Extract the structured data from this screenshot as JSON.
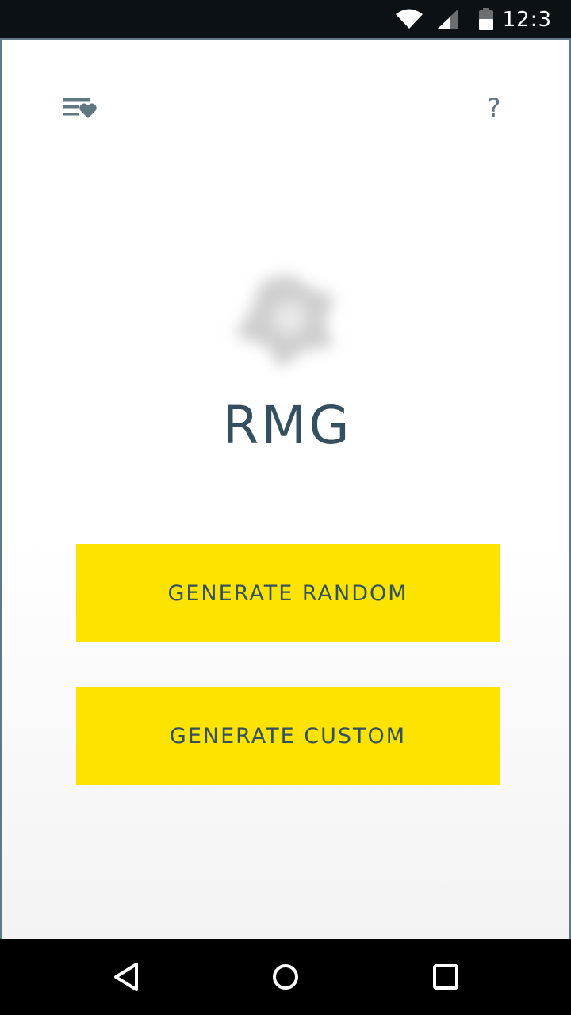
{
  "status_bar": {
    "time": "12:3",
    "icons": [
      "wifi-icon",
      "signal-icon",
      "battery-icon"
    ]
  },
  "toolbar": {
    "favorites_icon": "favorites-list-icon",
    "help_label": "?"
  },
  "main": {
    "logo_icon": "blurred-logo-icon",
    "title": "RMG",
    "buttons": {
      "random_label": "GENERATE RANDOM",
      "custom_label": "GENERATE CUSTOM"
    }
  },
  "navigation": {
    "icons": [
      "back-icon",
      "home-icon",
      "recents-icon"
    ]
  },
  "colors": {
    "accent": "#fde400",
    "text": "#34505f",
    "icon": "#5f7780"
  }
}
